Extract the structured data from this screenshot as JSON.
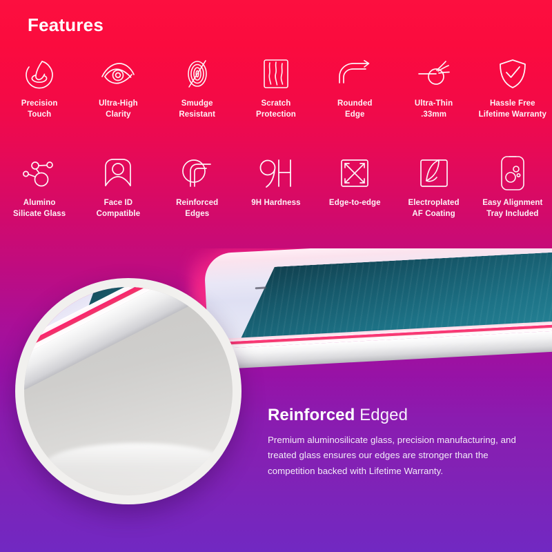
{
  "header": {
    "title": "Features"
  },
  "theme": {
    "gradient_top": "#fc0f3f",
    "gradient_bottom": "#7128c2",
    "icon_color": "#fdf4f7",
    "text_color": "#ffffff",
    "accent_pink": "#ff2e77"
  },
  "feature_rows": [
    {
      "items": [
        {
          "icon": "precision-touch-icon",
          "label": "Precision\nTouch"
        },
        {
          "icon": "eye-clarity-icon",
          "label": "Ultra-High\nClarity"
        },
        {
          "icon": "smudge-resistant-icon",
          "label": "Smudge\nResistant"
        },
        {
          "icon": "scratch-protection-icon",
          "label": "Scratch\nProtection"
        },
        {
          "icon": "rounded-edge-icon",
          "label": "Rounded\nEdge"
        },
        {
          "icon": "ultra-thin-icon",
          "label": "Ultra-Thin\n.33mm"
        },
        {
          "icon": "shield-check-icon",
          "label": "Hassle Free\nLifetime Warranty"
        }
      ]
    },
    {
      "items": [
        {
          "icon": "molecule-icon",
          "label": "Alumino\nSilicate Glass"
        },
        {
          "icon": "face-id-icon",
          "label": "Face ID\nCompatible"
        },
        {
          "icon": "reinforced-edges-icon",
          "label": "Reinforced\nEdges"
        },
        {
          "icon": "nine-h-hardness-icon",
          "label": "9H Hardness"
        },
        {
          "icon": "edge-to-edge-icon",
          "label": "Edge-to-edge"
        },
        {
          "icon": "electroplated-coating-icon",
          "label": "Electroplated\nAF Coating"
        },
        {
          "icon": "alignment-tray-icon",
          "label": "Easy Alignment\nTray Included"
        }
      ]
    }
  ],
  "hero": {
    "magnifier_name": "edge-magnifier-lens",
    "product_name": "tempered-glass-phone-edge"
  },
  "caption": {
    "title_strong": "Reinforced",
    "title_light": "Edged",
    "body": "Premium aluminosilicate glass, precision manufacturing, and treated glass ensures our edges are stronger than the competition backed with Lifetime Warranty."
  }
}
